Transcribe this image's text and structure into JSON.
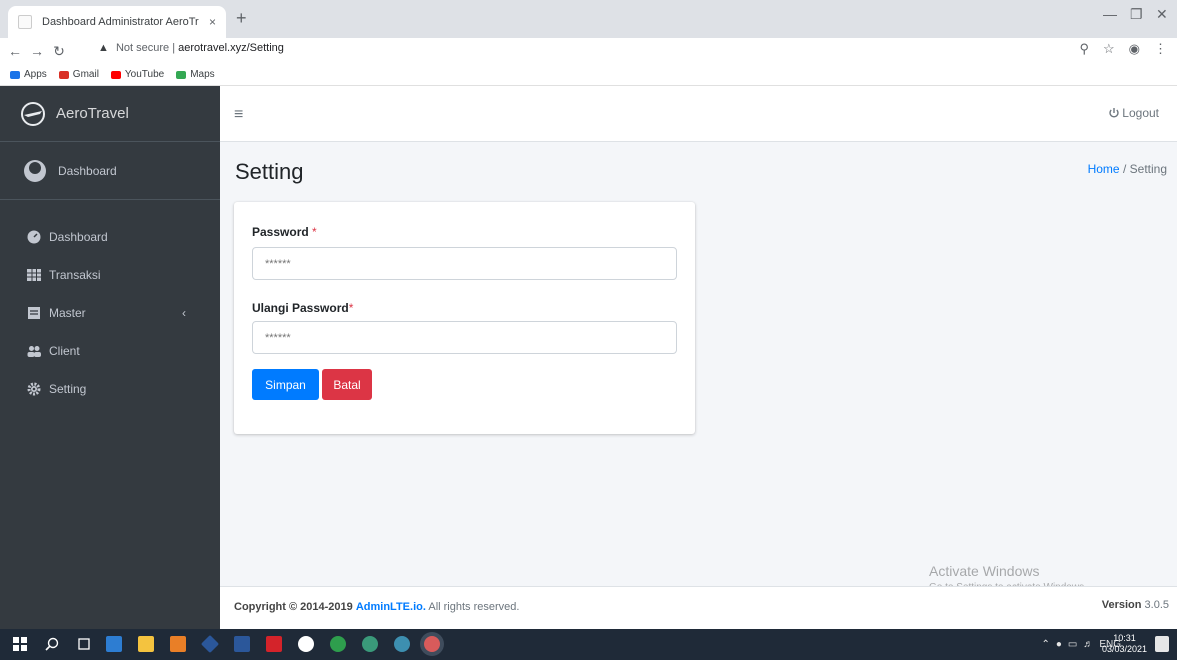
{
  "browser": {
    "tab_title": "Dashboard Administrator AeroTr",
    "tab_close": "×",
    "new_tab": "+",
    "url_security": "Not secure",
    "url_sep": "|",
    "url_host": "aerotravel.xyz/Setting",
    "bookmarks": [
      {
        "label": "Apps",
        "color": "#1a73e8"
      },
      {
        "label": "Gmail",
        "color": "#d93025"
      },
      {
        "label": "YouTube",
        "color": "#ff0000"
      },
      {
        "label": "Maps",
        "color": "#34a853"
      }
    ]
  },
  "sidebar": {
    "brand": "AeroTravel",
    "user": "Dashboard",
    "items": [
      {
        "label": "Dashboard",
        "icon": "tachometer-icon"
      },
      {
        "label": "Transaksi",
        "icon": "table-icon"
      },
      {
        "label": "Master",
        "icon": "book-icon",
        "chevron": "‹"
      },
      {
        "label": "Client",
        "icon": "users-icon"
      },
      {
        "label": "Setting",
        "icon": "cog-icon"
      }
    ]
  },
  "navbar": {
    "menu_glyph": "≡",
    "logout_label": "Logout"
  },
  "content": {
    "title": "Setting",
    "breadcrumb_home": "Home",
    "breadcrumb_sep": "/",
    "breadcrumb_current": "Setting",
    "form": {
      "password_label": "Password",
      "password_required": " *",
      "password_placeholder": "******",
      "repeat_label": "Ulangi Password",
      "repeat_required": "*",
      "repeat_placeholder": "******",
      "save_label": "Simpan",
      "cancel_label": "Batal"
    }
  },
  "footer": {
    "copyright_prefix": "Copyright © 2014-2019",
    "copyright_brand": "AdminLTE.io.",
    "copyright_suffix": "All rights reserved.",
    "version_label": "Version",
    "version_value": "3.0.5"
  },
  "windows": {
    "activate_title": "Activate Windows",
    "activate_sub": "Go to Settings to activate Windows.",
    "tray_lang": "ENG",
    "time": "10:31",
    "date": "03/03/2021"
  },
  "colors": {
    "sidebar_bg": "#343a40",
    "primary": "#007bff",
    "danger": "#dc3545"
  }
}
